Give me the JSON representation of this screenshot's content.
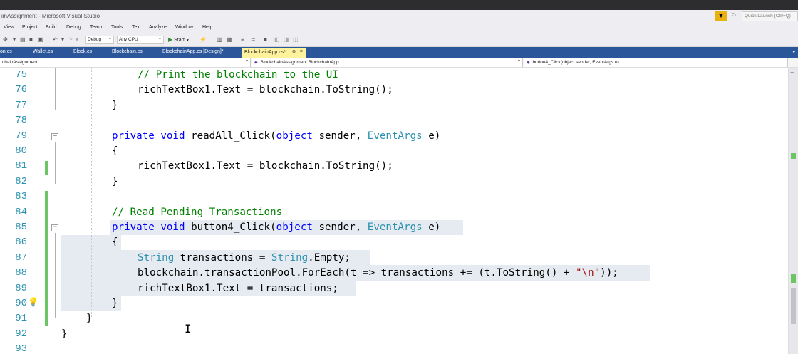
{
  "window": {
    "title": "iinAssignment - Microsoft Visual Studio"
  },
  "quick_launch": {
    "filter_icon": "filter-icon",
    "feedback_icon": "feedback-icon",
    "placeholder": "Quick Launch (Ctrl+Q)"
  },
  "menu": {
    "items": [
      "View",
      "Project",
      "Build",
      "Debug",
      "Team",
      "Tools",
      "Text",
      "Analyze",
      "Window",
      "Help"
    ]
  },
  "toolbar": {
    "config": "Debug",
    "platform": "Any CPU",
    "start_label": "Start"
  },
  "tabs": {
    "items": [
      "on.cs",
      "Wallet.cs",
      "Block.cs",
      "Blockchain.cs",
      "BlockchainApp.cs [Design]*"
    ],
    "active": "BlockchainApp.cs*",
    "active_pin": "⊕",
    "active_close": "×"
  },
  "navbar": {
    "project": "chainAssignment",
    "type": "BlockchainAssignment.BlockchainApp",
    "member": "button4_Click(object sender, EventArgs e)"
  },
  "editor": {
    "lines": [
      {
        "num": "75"
      },
      {
        "num": "76"
      },
      {
        "num": "77"
      },
      {
        "num": "78"
      },
      {
        "num": "79"
      },
      {
        "num": "80"
      },
      {
        "num": "81"
      },
      {
        "num": "82"
      },
      {
        "num": "83"
      },
      {
        "num": "84"
      },
      {
        "num": "85"
      },
      {
        "num": "86"
      },
      {
        "num": "87"
      },
      {
        "num": "88"
      },
      {
        "num": "89"
      },
      {
        "num": "90"
      },
      {
        "num": "91"
      },
      {
        "num": "92"
      },
      {
        "num": "93"
      }
    ],
    "tokens": {
      "comment_print": "// Print the blockchain to the UI",
      "rtb_text": "richTextBox1.Text = blockchain.ToString();",
      "close_brace": "}",
      "open_brace": "{",
      "private": "private",
      "void": "void",
      "readall_name": "readAll_Click(",
      "object": "object",
      "sender_comma": " sender, ",
      "eventargs": "EventArgs",
      "e_close": " e)",
      "comment_pending": "// Read Pending Transactions",
      "button4_name": "button4_Click(",
      "string_type": "String",
      "transactions_assign": " transactions = ",
      "string_empty_rest": ".Empty;",
      "foreach_pre": "blockchain.transactionPool.ForEach(t => transactions += (t.ToString() + ",
      "newline_literal": "\"\\n\"",
      "foreach_post": "));",
      "rtb_assign": "richTextBox1.Text = transactions;"
    }
  }
}
